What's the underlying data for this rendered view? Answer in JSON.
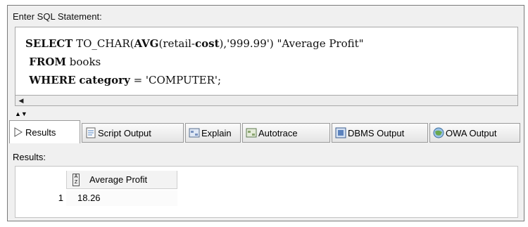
{
  "editor": {
    "label": "Enter SQL Statement:",
    "lines": [
      [
        {
          "t": "SELECT",
          "b": true
        },
        {
          "t": " TO_CHAR(",
          "b": false
        },
        {
          "t": "AVG",
          "b": true
        },
        {
          "t": "(retail-",
          "b": false
        },
        {
          "t": "cost",
          "b": true
        },
        {
          "t": "),'999.99') \"Average Profit\"",
          "b": false
        }
      ],
      [
        {
          "t": " FROM",
          "b": true
        },
        {
          "t": " books",
          "b": false
        }
      ],
      [
        {
          "t": " WHERE",
          "b": true
        },
        {
          "t": " ",
          "b": false
        },
        {
          "t": "category",
          "b": true
        },
        {
          "t": " = 'COMPUTER';",
          "b": false
        }
      ]
    ]
  },
  "tabs": [
    {
      "label": "Results",
      "icon": "play-arrow-icon",
      "active": true
    },
    {
      "label": "Script Output",
      "icon": "script-icon",
      "active": false
    },
    {
      "label": "Explain",
      "icon": "explain-icon",
      "active": false
    },
    {
      "label": "Autotrace",
      "icon": "autotrace-icon",
      "active": false
    },
    {
      "label": "DBMS Output",
      "icon": "dbms-icon",
      "active": false
    },
    {
      "label": "OWA Output",
      "icon": "owa-globe-icon",
      "active": false
    }
  ],
  "results": {
    "label": "Results:",
    "columns": [
      "Average Profit"
    ],
    "rows": [
      {
        "num": "1",
        "cells": [
          "18.26"
        ]
      }
    ]
  }
}
